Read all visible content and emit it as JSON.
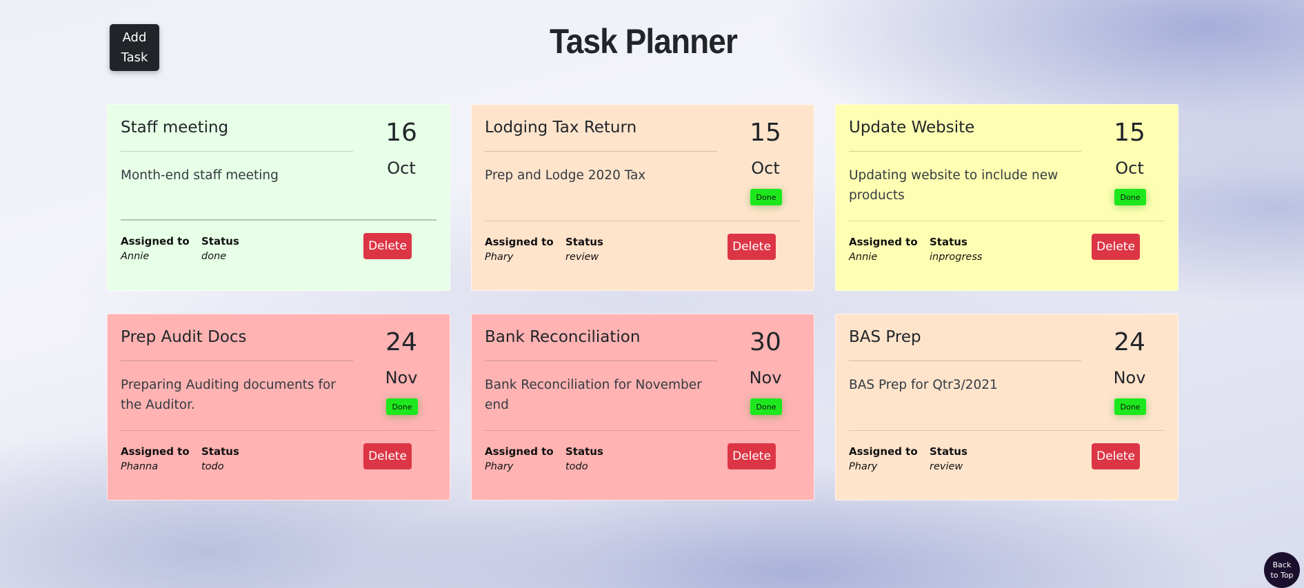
{
  "header": {
    "add_button": "Add\nTask",
    "title": "Task Planner"
  },
  "labels": {
    "assigned_to": "Assigned to",
    "status": "Status",
    "delete": "Delete",
    "done": "Done"
  },
  "tasks": [
    {
      "title": "Staff meeting",
      "description": "Month-end staff meeting",
      "day": "16",
      "month": "Oct",
      "assignee": "Annie",
      "status": "done",
      "color": "#e6ffe6",
      "show_done": false
    },
    {
      "title": "Lodging Tax Return",
      "description": "Prep and Lodge 2020 Tax",
      "day": "15",
      "month": "Oct",
      "assignee": "Phary",
      "status": "review",
      "color": "#ffe4cc",
      "show_done": true
    },
    {
      "title": "Update Website",
      "description": "Updating website to include new products",
      "day": "15",
      "month": "Oct",
      "assignee": "Annie",
      "status": "inprogress",
      "color": "#ffffb3",
      "show_done": true
    },
    {
      "title": "Prep Audit Docs",
      "description": "Preparing Auditing documents for the Auditor.",
      "day": "24",
      "month": "Nov",
      "assignee": "Phanna",
      "status": "todo",
      "color": "#ffb3b3",
      "show_done": true
    },
    {
      "title": "Bank Reconciliation",
      "description": "Bank Reconciliation for November end",
      "day": "30",
      "month": "Nov",
      "assignee": "Phary",
      "status": "todo",
      "color": "#ffb3b3",
      "show_done": true
    },
    {
      "title": "BAS Prep",
      "description": "BAS Prep for Qtr3/2021",
      "day": "24",
      "month": "Nov",
      "assignee": "Phary",
      "status": "review",
      "color": "#ffe4cc",
      "show_done": true
    }
  ],
  "back_to_top": "Back\nto Top"
}
